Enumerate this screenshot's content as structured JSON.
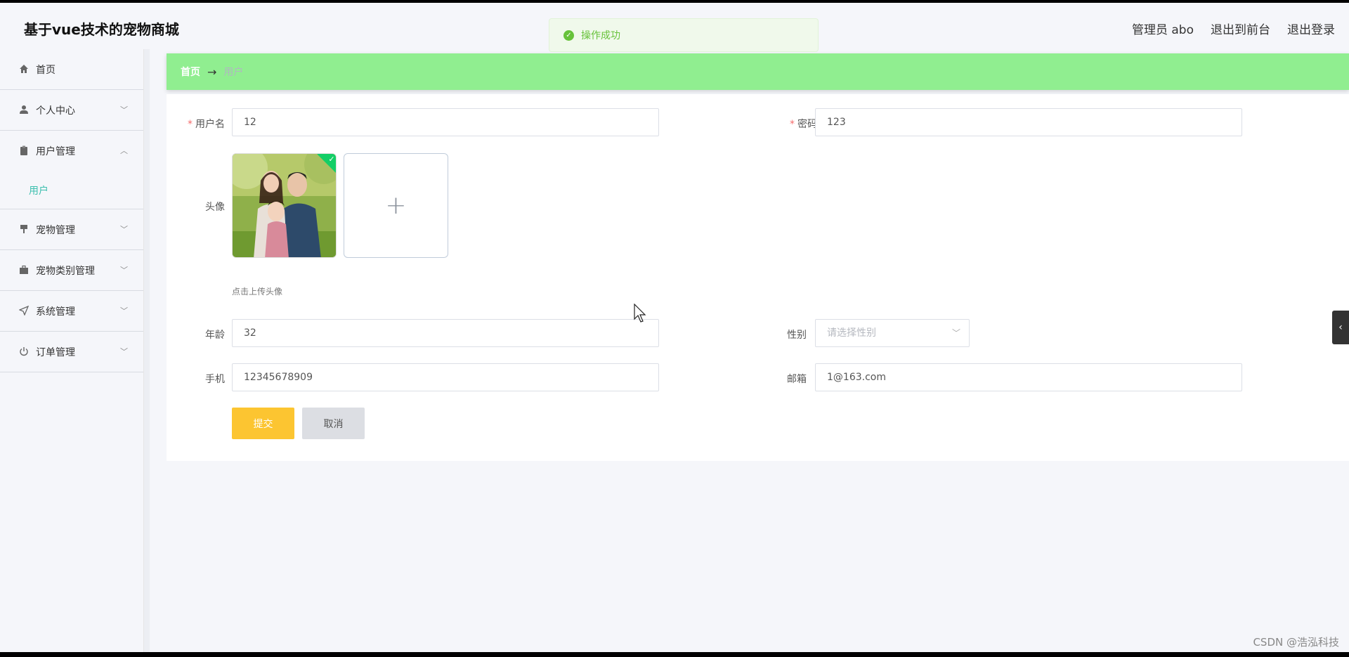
{
  "header": {
    "title": "基于vue技术的宠物商城",
    "admin_label": "管理员 abo",
    "exit_front": "退出到前台",
    "logout": "退出登录"
  },
  "toast": {
    "message": "操作成功"
  },
  "sidebar": {
    "items": [
      {
        "label": "首页",
        "icon": "home-icon"
      },
      {
        "label": "个人中心",
        "icon": "user-icon",
        "expandable": true
      },
      {
        "label": "用户管理",
        "icon": "clipboard-icon",
        "expandable": true,
        "expanded": true
      },
      {
        "label": "宠物管理",
        "icon": "brush-icon",
        "expandable": true
      },
      {
        "label": "宠物类别管理",
        "icon": "briefcase-icon",
        "expandable": true
      },
      {
        "label": "系统管理",
        "icon": "send-icon",
        "expandable": true
      },
      {
        "label": "订单管理",
        "icon": "power-icon",
        "expandable": true
      }
    ],
    "sub_item": "用户"
  },
  "breadcrumb": {
    "home": "首页",
    "arrow": "→",
    "current": "用户"
  },
  "form": {
    "username_label": "用户名",
    "username_value": "12",
    "password_label": "密码",
    "password_value": "123",
    "avatar_label": "头像",
    "upload_tip": "点击上传头像",
    "age_label": "年龄",
    "age_value": "32",
    "gender_label": "性别",
    "gender_placeholder": "请选择性别",
    "phone_label": "手机",
    "phone_value": "12345678909",
    "email_label": "邮箱",
    "email_value": "1@163.com",
    "submit": "提交",
    "cancel": "取消"
  },
  "watermark": "CSDN @浩泓科技",
  "colors": {
    "breadcrumb_bg": "#90ee90",
    "submit_bg": "#fcc531",
    "active_sub": "#3cbfae",
    "toast_text": "#67c23a"
  }
}
